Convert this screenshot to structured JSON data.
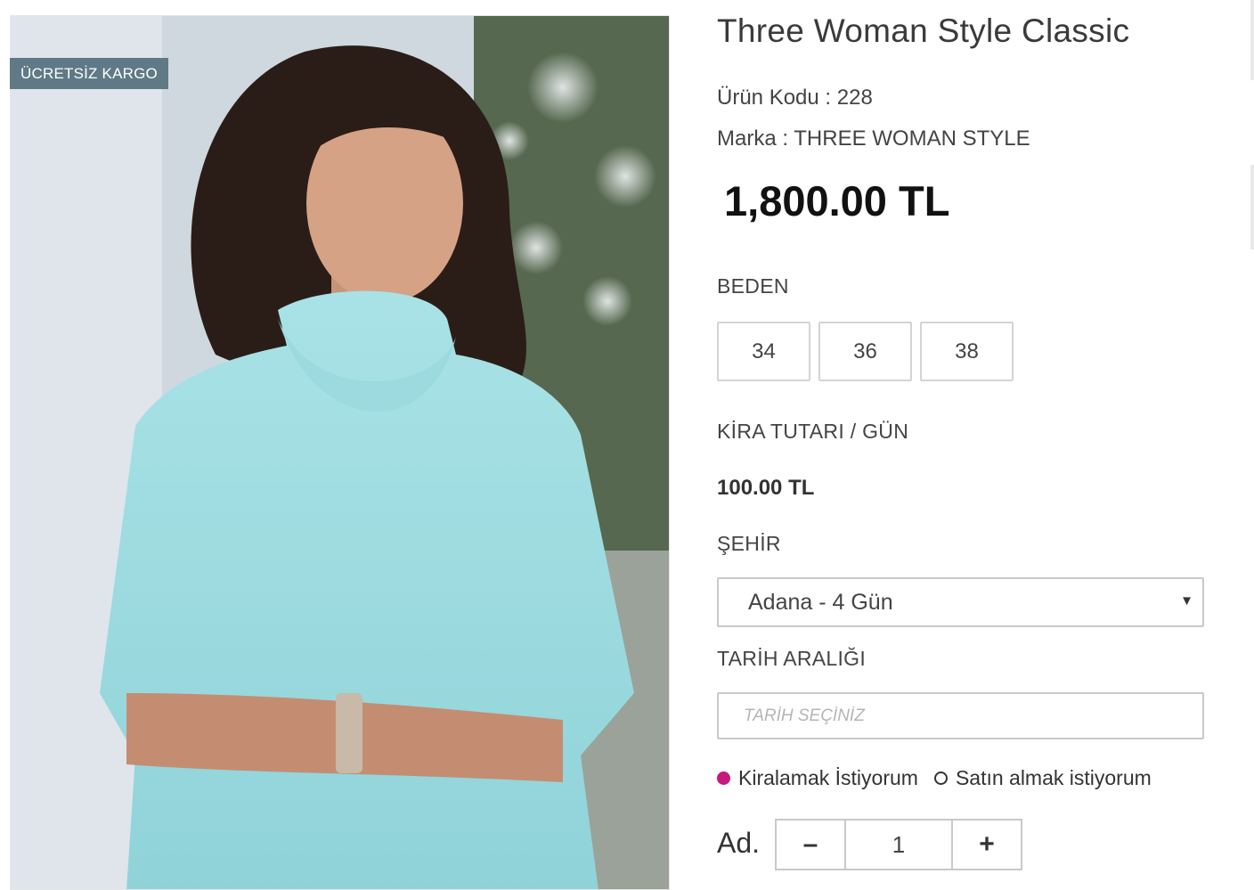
{
  "product": {
    "title": "Three Woman Style Classic",
    "badge": "ÜCRETSİZ KARGO",
    "code_label": "Ürün Kodu : 228",
    "brand_label": "Marka : THREE WOMAN STYLE",
    "price": "1,800.00 TL"
  },
  "size": {
    "label": "BEDEN",
    "options": [
      "34",
      "36",
      "38"
    ]
  },
  "rent": {
    "label": "KİRA TUTARI / GÜN",
    "price": "100.00 TL"
  },
  "city": {
    "label": "ŞEHİR",
    "selected": "Adana - 4 Gün"
  },
  "date_range": {
    "label": "TARİH ARALIĞI",
    "placeholder": "TARİH SEÇİNİZ"
  },
  "purchase_type": {
    "rent_label": "Kiralamak İstiyorum",
    "buy_label": "Satın almak istiyorum",
    "selected": "rent",
    "accent_color": "#c8187c"
  },
  "quantity": {
    "label": "Ad.",
    "value": "1",
    "minus": "–",
    "plus": "+"
  },
  "colors": {
    "badge_bg": "#5f7a86",
    "border": "#c9c9c9"
  }
}
